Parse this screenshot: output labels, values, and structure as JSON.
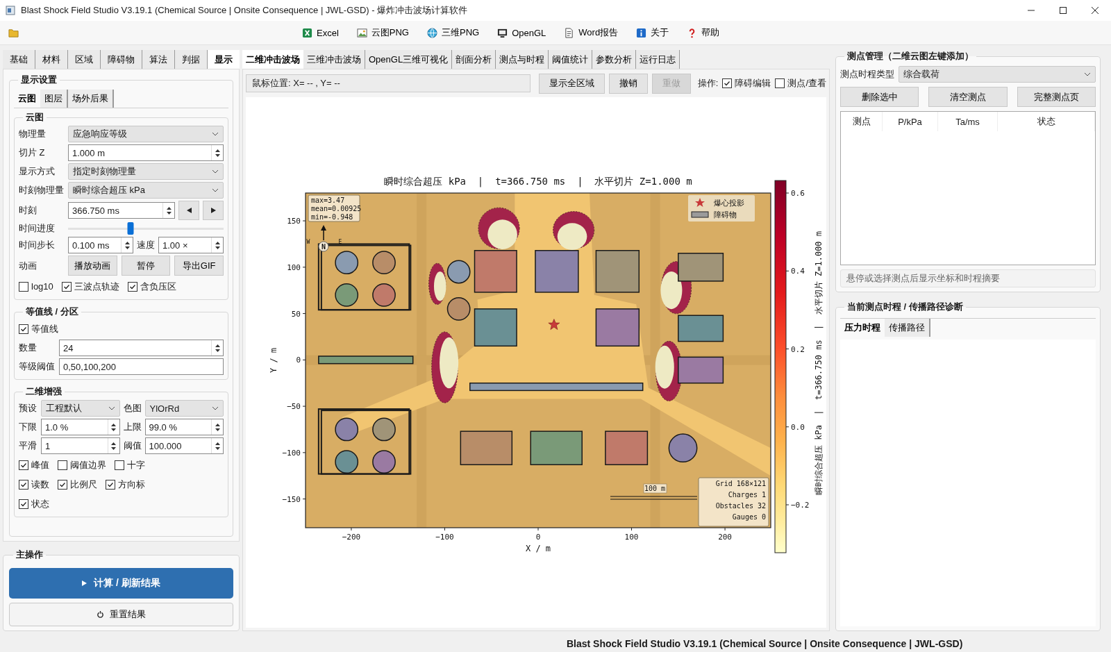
{
  "window": {
    "title": "Blast Shock Field Studio V3.19.1 (Chemical Source | Onsite Consequence | JWL-GSD) - 爆炸冲击波场计算软件"
  },
  "toolbar": [
    {
      "kind": "folder"
    },
    {
      "kind": "excel",
      "label": "Excel"
    },
    {
      "kind": "image",
      "label": "云图PNG"
    },
    {
      "kind": "globe",
      "label": "三维PNG"
    },
    {
      "kind": "monitor",
      "label": "OpenGL"
    },
    {
      "kind": "document",
      "label": "Word报告"
    },
    {
      "kind": "info",
      "label": "关于"
    },
    {
      "kind": "help",
      "label": "帮助"
    }
  ],
  "left_tabs": [
    {
      "label": "基础",
      "selected": false
    },
    {
      "label": "材料",
      "selected": false
    },
    {
      "label": "区域",
      "selected": false
    },
    {
      "label": "障碍物",
      "selected": false
    },
    {
      "label": "算法",
      "selected": false
    },
    {
      "label": "判据",
      "selected": false
    },
    {
      "label": "显示",
      "selected": true
    }
  ],
  "display_settings": {
    "title": "显示设置",
    "tabs": [
      {
        "label": "云图",
        "selected": true
      },
      {
        "label": "图层",
        "selected": false
      },
      {
        "label": "场外后果",
        "selected": false
      }
    ],
    "groups": [
      {
        "title": "云图",
        "rows": [
          {
            "kind": "select",
            "label": "物理量",
            "value": "应急响应等级"
          },
          {
            "kind": "spin",
            "label": "切片 Z",
            "value": "1.000 m"
          },
          {
            "kind": "select",
            "label": "显示方式",
            "value": "指定时刻物理量"
          },
          {
            "kind": "select",
            "label": "时刻物理量",
            "value": "瞬时综合超压 kPa"
          },
          {
            "kind": "time",
            "label": "时刻",
            "value": "366.750 ms"
          },
          {
            "kind": "slider",
            "label": "时间进度",
            "level": 0.4
          },
          {
            "kind": "pair",
            "label": "时间步长",
            "fields": [
              {
                "kind": "spin",
                "value": "0.100 ms"
              },
              {
                "kind": "spin",
                "label": "速度",
                "value": "1.00 ×"
              }
            ]
          },
          {
            "kind": "buttons",
            "label": "动画",
            "buttons": [
              "播放动画",
              "暂停",
              "导出GIF"
            ]
          },
          {
            "kind": "checks",
            "items": [
              {
                "label": "log10",
                "checked": false
              },
              {
                "label": "三波点轨迹",
                "checked": true
              },
              {
                "label": "含负压区",
                "checked": true
              }
            ]
          }
        ]
      },
      {
        "title": "等值线 / 分区",
        "rows": [
          {
            "kind": "checks",
            "items": [
              {
                "label": "等值线",
                "checked": true
              }
            ]
          },
          {
            "kind": "spin",
            "label": "数量",
            "value": "24"
          },
          {
            "kind": "text",
            "label": "等级阈值",
            "value": "0,50,100,200"
          }
        ]
      },
      {
        "title": "二维增强",
        "rows": [
          {
            "kind": "pair",
            "label": "预设",
            "fields": [
              {
                "kind": "select",
                "value": "工程默认"
              },
              {
                "kind": "select",
                "label": "色图",
                "value": "YlOrRd"
              }
            ]
          },
          {
            "kind": "pair",
            "label": "下限",
            "fields": [
              {
                "kind": "spin",
                "value": "1.0 %"
              },
              {
                "kind": "spin",
                "label": "上限",
                "value": "99.0 %"
              }
            ]
          },
          {
            "kind": "pair",
            "label": "平滑",
            "fields": [
              {
                "kind": "spin",
                "value": "1"
              },
              {
                "kind": "spin",
                "label": "阈值",
                "value": "100.000"
              }
            ]
          },
          {
            "kind": "checks",
            "items": [
              {
                "label": "峰值",
                "checked": true
              },
              {
                "label": "阈值边界",
                "checked": false
              },
              {
                "label": "十字",
                "checked": false
              }
            ]
          },
          {
            "kind": "checks",
            "items": [
              {
                "label": "读数",
                "checked": true
              },
              {
                "label": "比例尺",
                "checked": true
              },
              {
                "label": "方向标",
                "checked": true
              }
            ]
          },
          {
            "kind": "checks",
            "items": [
              {
                "label": "状态",
                "checked": true
              }
            ]
          }
        ]
      }
    ]
  },
  "main_actions": {
    "title": "主操作",
    "buttons": [
      {
        "kind": "primary",
        "label": "计算 / 刷新结果"
      },
      {
        "kind": "reset",
        "label": "重置结果"
      }
    ]
  },
  "view_tabs": [
    {
      "label": "二维冲击波场",
      "selected": true
    },
    {
      "label": "三维冲击波场",
      "selected": false
    },
    {
      "label": "OpenGL三维可视化",
      "selected": false
    },
    {
      "label": "剖面分析",
      "selected": false
    },
    {
      "label": "测点与时程",
      "selected": false
    },
    {
      "label": "阈值统计",
      "selected": false
    },
    {
      "label": "参数分析",
      "selected": false
    },
    {
      "label": "运行日志",
      "selected": false
    }
  ],
  "view_toolbar": {
    "mouse_position": "鼠标位置: X= -- , Y= --",
    "buttons": [
      {
        "label": "显示全区域",
        "disabled": false
      },
      {
        "label": "撤销",
        "disabled": false
      },
      {
        "label": "重做",
        "disabled": true
      }
    ],
    "operation_label": "操作:",
    "options": [
      {
        "label": "障碍编辑",
        "checked": true
      },
      {
        "label": "测点/查看",
        "checked": false
      }
    ]
  },
  "plot": {
    "title": "瞬时综合超压 kPa  |  t=366.750 ms  |  水平切片 Z=1.000 m",
    "xlabel": "X / m",
    "ylabel": "Y / m",
    "xticks": [
      "−200",
      "−100",
      "0",
      "100",
      "200"
    ],
    "yticks": [
      "150",
      "100",
      "50",
      "0",
      "−50",
      "−100",
      "−150"
    ],
    "stats": [
      "max=3.47",
      "mean=0.00925",
      "min=-0.948"
    ],
    "compass": [
      "W",
      "N",
      "E"
    ],
    "legend": [
      {
        "kind": "star",
        "label": "爆心投影"
      },
      {
        "kind": "obstacle",
        "label": "障碍物"
      }
    ],
    "scale_label": "100 m",
    "grid_info": [
      "Grid 168×121",
      "Charges 1",
      "Obstacles 32",
      "Gauges 0"
    ],
    "colorbar": {
      "label": "瞬时综合超压 kPa  |  t=366.750 ms  |  水平切片 Z=1.000 m",
      "ticks": [
        "0.6",
        "0.4",
        "0.2",
        "0.0",
        "−0.2"
      ]
    }
  },
  "gauges": {
    "title": "测点管理（二维云图左键添加）",
    "type_label": "测点时程类型",
    "type_value": "综合载荷",
    "buttons": [
      "删除选中",
      "清空测点",
      "完整测点页"
    ],
    "columns": [
      "测点",
      "P/kPa",
      "Ta/ms",
      "状态"
    ],
    "hint": "悬停或选择测点后显示坐标和时程摘要"
  },
  "diagnosis": {
    "title": "当前测点时程 / 传播路径诊断",
    "tabs": [
      {
        "label": "压力时程",
        "selected": true
      },
      {
        "label": "传播路径",
        "selected": false
      }
    ]
  },
  "status_bar": "Blast Shock Field Studio V3.19.1 (Chemical Source | Onsite Consequence | JWL-GSD)"
}
